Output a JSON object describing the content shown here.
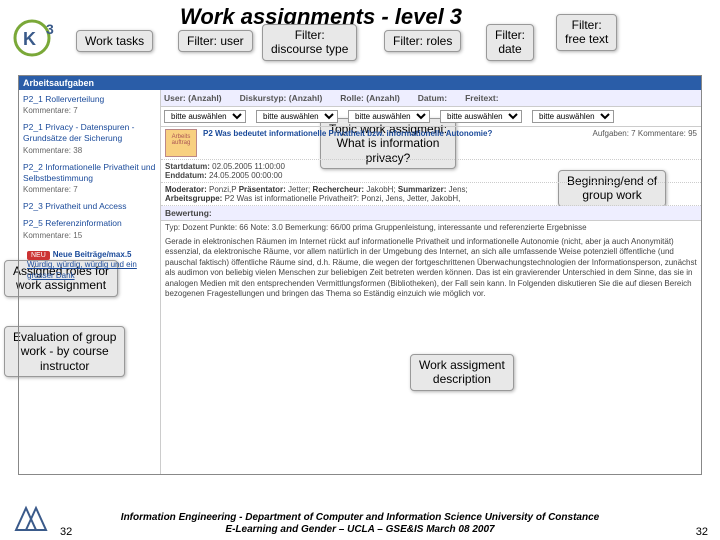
{
  "slide": {
    "title": "Work assignments - level 3"
  },
  "callouts": {
    "work_tasks": "Work tasks",
    "filter_user": "Filter: user",
    "filter_discourse": "Filter:\ndiscourse type",
    "filter_roles": "Filter: roles",
    "filter_date": "Filter:\ndate",
    "filter_freetext": "Filter:\nfree text",
    "topic": "Topic work assigment:\nWhat is information\nprivacy?",
    "beginning_end": "Beginning/end of\ngroup work",
    "assigned_roles": "Assigned roles for\nwork assignment",
    "evaluation": "Evaluation of group\nwork - by course\ninstructor",
    "work_desc": "Work assigment\ndescription"
  },
  "screenshot": {
    "bluebar": "Arbeitsaufgaben",
    "left_items": [
      {
        "title": "P2_1 Rollerverteilung",
        "sub": "Kommentare: 7"
      },
      {
        "title": "P2_1 Privacy - Datenspuren - Grundsätze der Sicherung",
        "sub": "Kommentare: 38"
      },
      {
        "title": "P2_2 Informationelle Privatheit und Selbstbestimmung",
        "sub": "Kommentare: 7"
      },
      {
        "title": "P2_3 Privatheit und Access",
        "sub": ""
      },
      {
        "title": "P2_5 Referenzinformation",
        "sub": "Kommentare: 15"
      }
    ],
    "filters": {
      "user": "User: (Anzahl)",
      "discourse": "Diskurstyp: (Anzahl)",
      "role": "Rolle: (Anzahl)",
      "date": "Datum:",
      "freetext": "Freitext:"
    },
    "selects": {
      "placeholder": "bitte auswählen"
    },
    "topic": {
      "icon_label": "Arbeits\nauftrag",
      "title": "P2 Was bedeutet informationelle Privatheit bzw. informationelle Autonomie?",
      "meta": "Aufgaben: 7   Kommentare: 95"
    },
    "dates": {
      "start_label": "Startdatum:",
      "start_value": "02.05.2005 11:00:00",
      "end_label": "Enddatum:",
      "end_value": "24.05.2005 00:00:00"
    },
    "moderators": {
      "mod_label": "Moderator:",
      "mod_value": "Ponzi,P",
      "pres_label": "Präsentator:",
      "pres_value": "Jetter;",
      "rech_label": "Rechercheur:",
      "rech_value": "JakobH;",
      "summ_label": "Summarizer:",
      "summ_value": "Jens;",
      "group_label": "Arbeitsgruppe:",
      "group_value": "P2 Was ist informationelle Privatheit?: Ponzi, Jens, Jetter, JakobH,"
    },
    "eval_header": "Bewertung:",
    "eval_text": "Typ: Dozent  Punkte: 66  Note: 3.0  Bemerkung: 66/00 prima Gruppenleistung, interessante und referenzierte Ergebnisse",
    "description": "Gerade in elektronischen Räumen im Internet rückt auf informationelle Privatheit und informationelle Autonomie (nicht, aber ja auch Anonymität) essenzial, da elektronische Räume, vor allem natürlich in der Umgebung des Internet, an sich alle umfassende Weise potenziell öffentliche (und pauschal faktisch) öffentliche Räume sind, d.h. Räume, die wegen der fortgeschrittenen Überwachungstechnologien der Informationsperson, zunächst als audimon von beliebig vielen Menschen zur beliebigen Zeit betreten werden können. Das ist ein gravierender Unterschied in dem Sinne, das sie in analogen Medien mit den entsprechenden Vermittlungsformen (Bibliotheken), der Fall sein kann. In Folgenden diskutieren Sie die auf diesen Bereich bezogenen Fragestellungen und bringen das Thema so Eständig einzuich wie möglich vor.",
    "neu": {
      "badge": "NEU",
      "label": "Neue Beiträge/max.5",
      "link": "Würdig, würdig, würdig und ein grosser Dank"
    }
  },
  "footer": {
    "line1": "Information Engineering - Department of Computer and Information Science University of Constance",
    "line2": "E-Learning and Gender – UCLA – GSE&IS March 08 2007",
    "page": "32"
  }
}
